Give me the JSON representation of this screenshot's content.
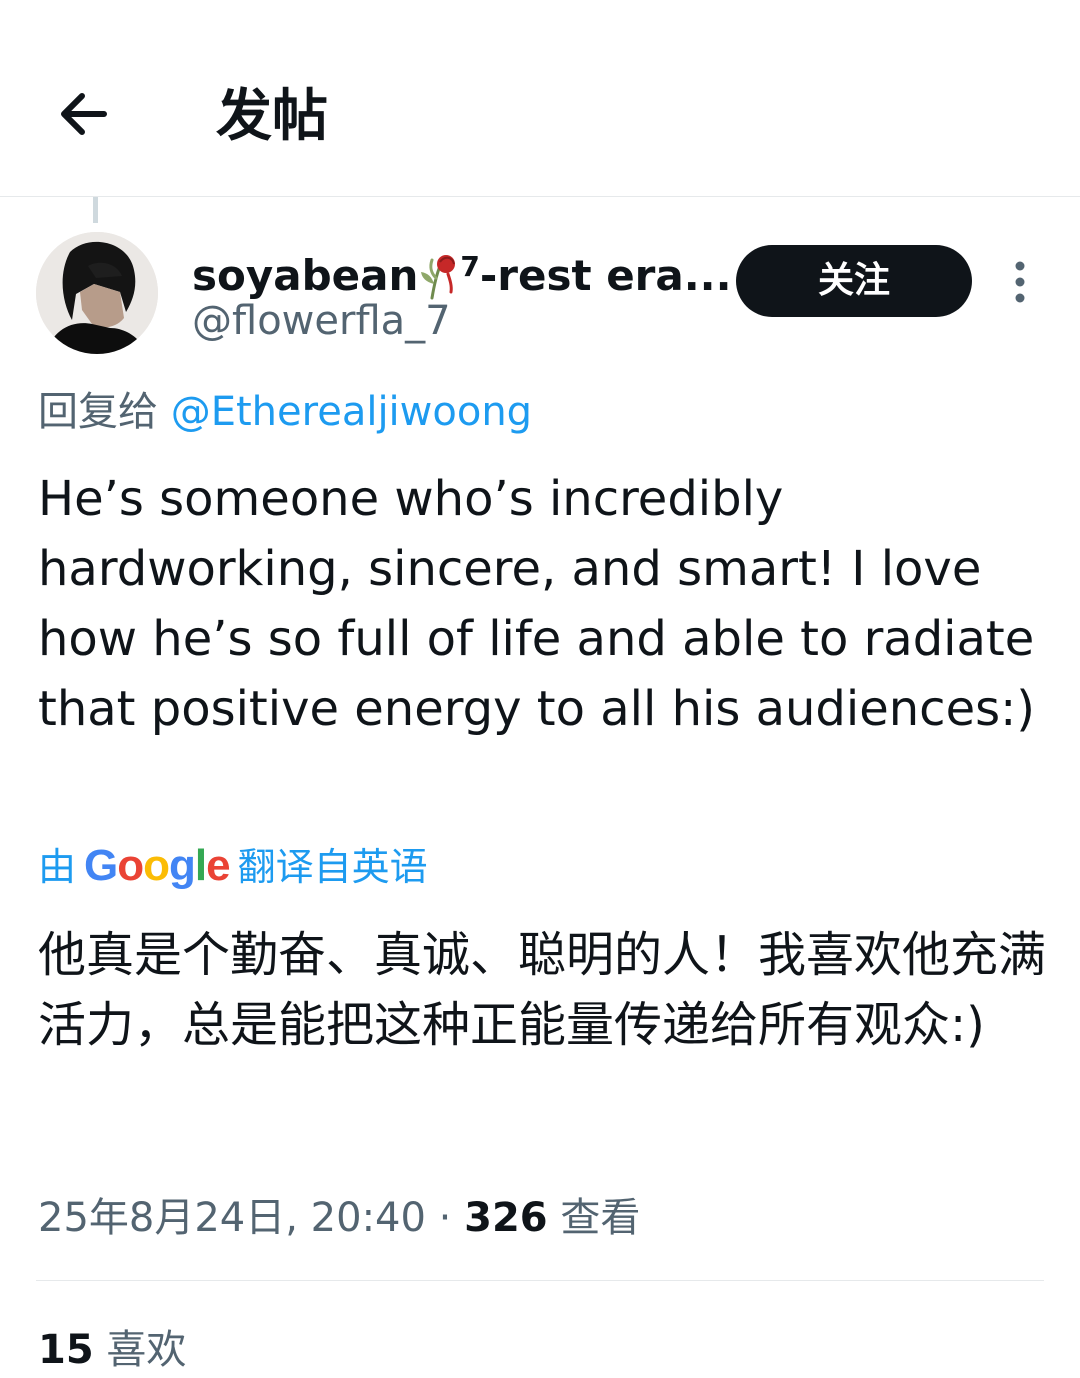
{
  "header": {
    "title": "发帖",
    "back_icon": "arrow-left-icon"
  },
  "tweet": {
    "author": {
      "display_name": "soyabean",
      "name_emoji": "wilted-rose-emoji",
      "name_superscript": "7",
      "name_suffix": "-rest era...",
      "handle": "@flowerfla_7"
    },
    "follow_label": "关注",
    "more_icon": "more-vertical-icon",
    "reply_prefix": "回复给",
    "reply_to": "@Etherealjiwoong",
    "text": "He’s someone who’s incredibly hardworking, sincere, and smart! I love how he’s so full of life and able to radiate that positive energy to all his audiences:)",
    "translation": {
      "prefix": "由",
      "provider_letters": [
        "G",
        "o",
        "o",
        "g",
        "l",
        "e"
      ],
      "suffix": "翻译自英语",
      "text": "他真是个勤奋、真诚、聪明的人！我喜欢他充满活力，总是能把这种正能量传递给所有观众:)"
    },
    "timestamp": "25年8月24日, 20:40",
    "separator": " · ",
    "views_count": "326",
    "views_label": "查看",
    "likes_count": "15",
    "likes_label": "喜欢"
  },
  "colors": {
    "text_primary": "#0f1419",
    "text_secondary": "#536471",
    "link": "#1d9bf0",
    "button_bg": "#0f1419",
    "divider": "#e6e9eb",
    "google_blue": "#4285f4",
    "google_red": "#ea4335",
    "google_yellow": "#fbbc05",
    "google_green": "#34a853"
  }
}
